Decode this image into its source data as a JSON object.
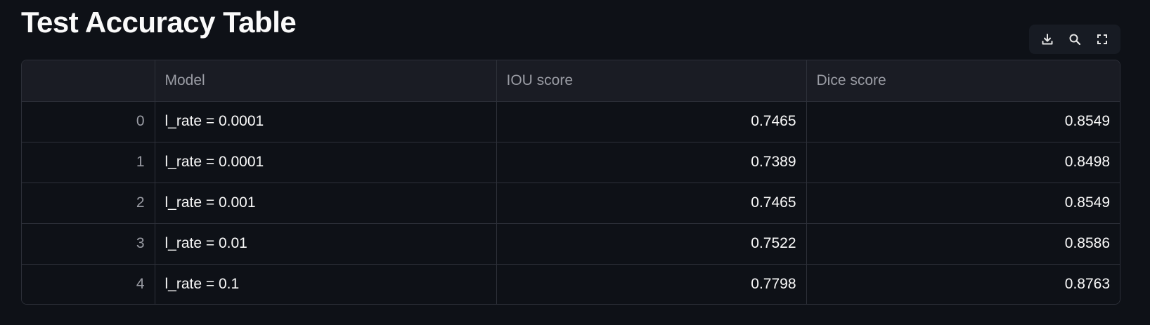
{
  "page": {
    "title": "Test Accuracy Table"
  },
  "toolbar": {
    "icons": [
      "download-icon",
      "search-icon",
      "fullscreen-icon"
    ]
  },
  "table": {
    "columns": [
      "",
      "Model",
      "IOU score",
      "Dice score"
    ],
    "rows": [
      {
        "index": "0",
        "model": "l_rate = 0.0001",
        "iou": "0.7465",
        "dice": "0.8549"
      },
      {
        "index": "1",
        "model": "l_rate = 0.0001",
        "iou": "0.7389",
        "dice": "0.8498"
      },
      {
        "index": "2",
        "model": "l_rate = 0.001",
        "iou": "0.7465",
        "dice": "0.8549"
      },
      {
        "index": "3",
        "model": "l_rate = 0.01",
        "iou": "0.7522",
        "dice": "0.8586"
      },
      {
        "index": "4",
        "model": "l_rate = 0.1",
        "iou": "0.7798",
        "dice": "0.8763"
      }
    ]
  },
  "colors": {
    "background": "#0e1117",
    "header_background": "#1a1c24",
    "border": "#2d3039",
    "text": "#fafafa",
    "muted_text": "#9a9ca4"
  }
}
